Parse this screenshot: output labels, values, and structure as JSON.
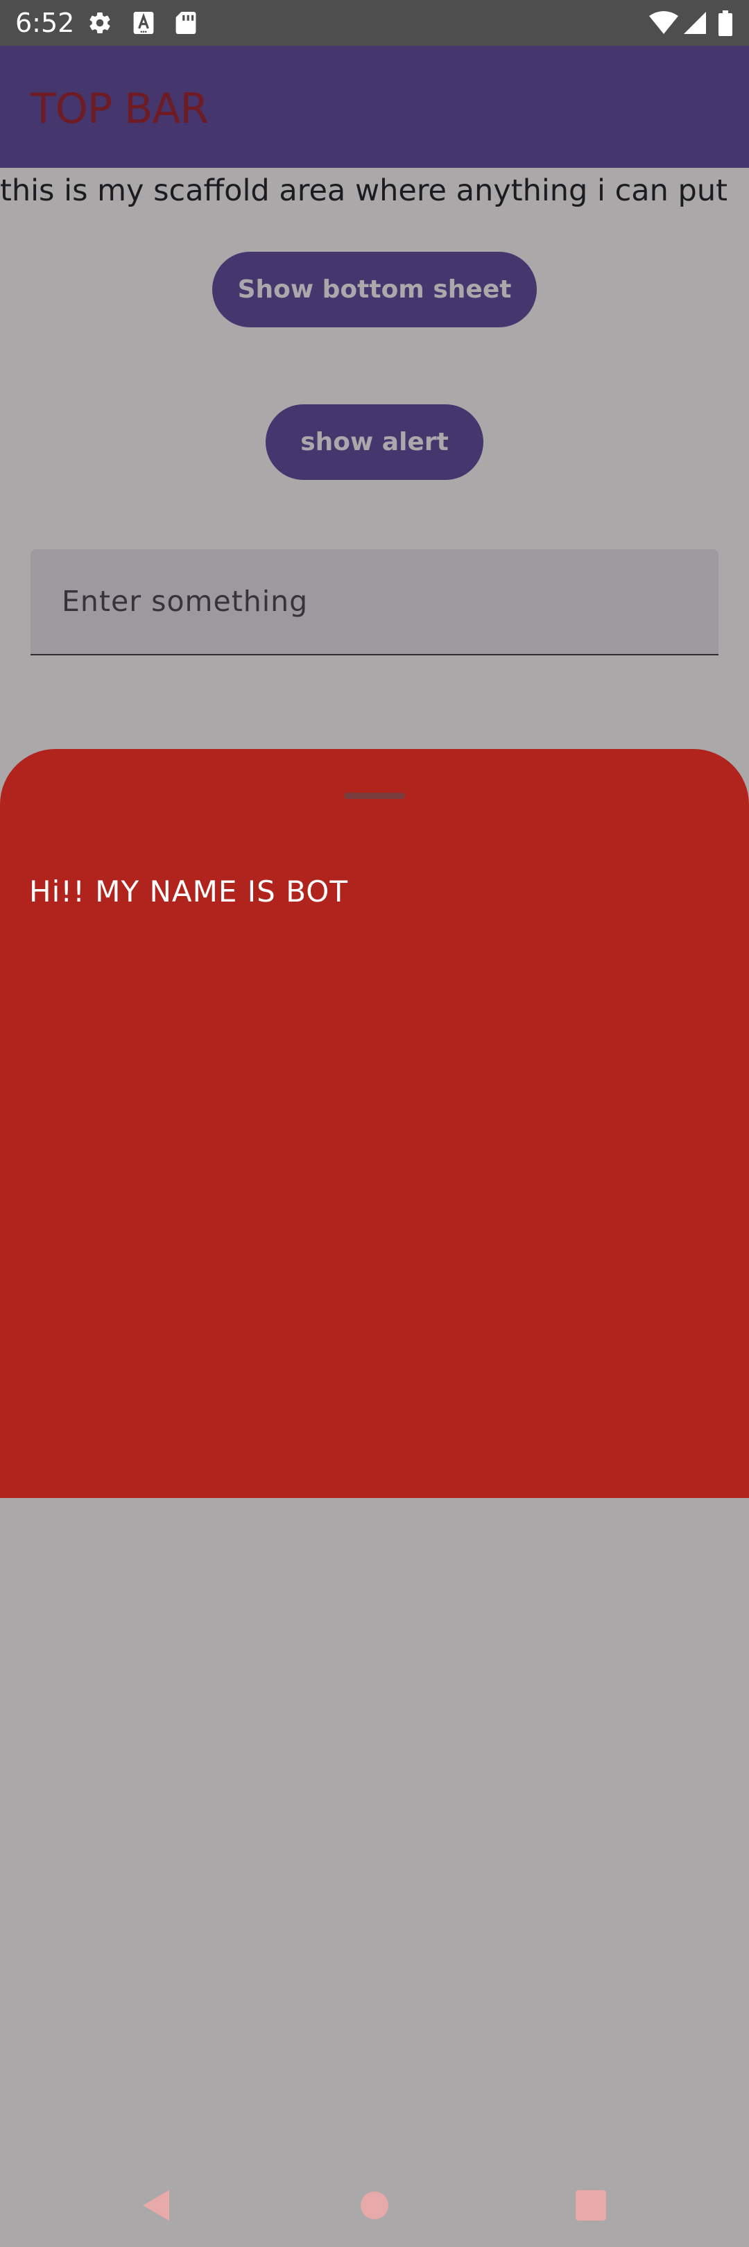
{
  "status_bar": {
    "time": "6:52",
    "icons": [
      "gear-icon",
      "font-a-icon",
      "sd-card-icon",
      "wifi-icon",
      "signal-icon",
      "battery-icon"
    ]
  },
  "top_bar": {
    "title": "TOP BAR"
  },
  "main": {
    "scaffold_text": "this is my scaffold area where anything i can put",
    "show_bottom_sheet_label": "Show bottom sheet",
    "show_alert_label": "show alert",
    "text_field": {
      "placeholder": "Enter something",
      "value": ""
    }
  },
  "bottom_sheet": {
    "text": "Hi!! MY NAME IS BOT"
  },
  "nav_bar": {
    "icons": [
      "back-icon",
      "home-icon",
      "recents-icon"
    ]
  },
  "colors": {
    "status_bar": "#4e4e4e",
    "top_bar": "#45366d",
    "top_bar_title": "#6e1b23",
    "scrim_background": "#aaa8a9",
    "button": "#45366d",
    "button_text": "#aaa8ab",
    "text_field": "#9e999f",
    "bottom_sheet": "#b1241e",
    "bottom_sheet_text": "#ffffff"
  }
}
